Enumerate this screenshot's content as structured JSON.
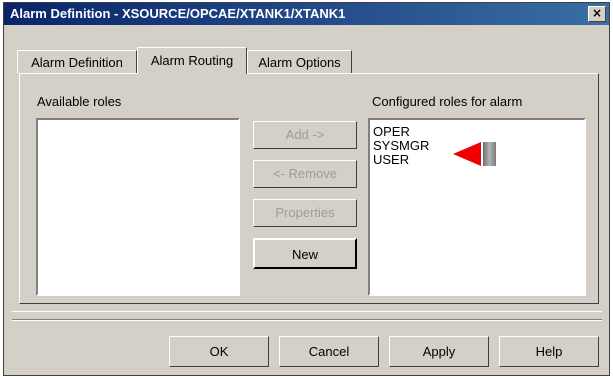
{
  "window": {
    "title": "Alarm Definition - XSOURCE/OPCAE/XTANK1/XTANK1",
    "close_glyph": "×"
  },
  "tabs": [
    {
      "label": "Alarm Definition",
      "active": false
    },
    {
      "label": "Alarm Routing",
      "active": true
    },
    {
      "label": "Alarm Options",
      "active": false
    }
  ],
  "available_roles": {
    "label": "Available roles",
    "items": []
  },
  "configured_roles": {
    "label": "Configured roles for alarm",
    "items": [
      "OPER",
      "SYSMGR",
      "USER"
    ]
  },
  "role_buttons": {
    "add": {
      "label": "Add ->",
      "enabled": false
    },
    "remove": {
      "label": "<- Remove",
      "enabled": false
    },
    "properties": {
      "label": "Properties",
      "enabled": false
    },
    "new": {
      "label": "New",
      "enabled": true
    }
  },
  "footer_buttons": {
    "ok": "OK",
    "cancel": "Cancel",
    "apply": "Apply",
    "help": "Help"
  },
  "annotation": {
    "arrow_color": "#ee0000",
    "points_to": "SYSMGR"
  }
}
